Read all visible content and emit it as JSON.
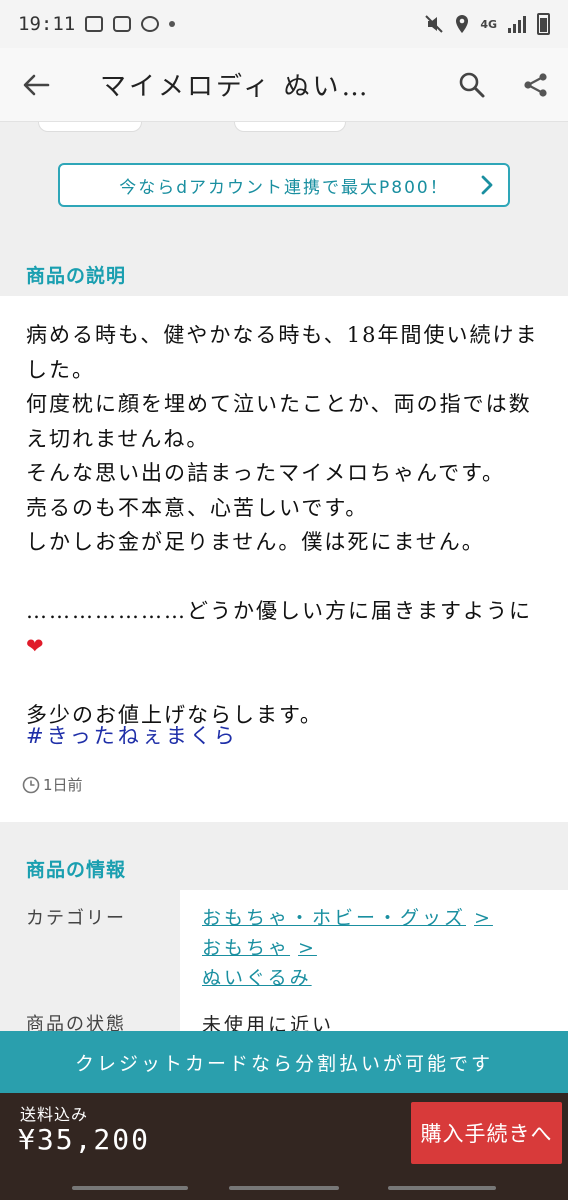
{
  "status_bar": {
    "time": "19:11",
    "network": "4G",
    "icons": [
      "image-icon",
      "app-icon",
      "chat-icon",
      "mute-icon",
      "location-icon",
      "signal-icon",
      "battery-icon"
    ]
  },
  "header": {
    "title": "マイメロディ ぬい…",
    "icons": [
      "back-arrow-icon",
      "search-icon",
      "share-icon"
    ]
  },
  "banner": {
    "text": "今ならdアカウント連携で最大P800！"
  },
  "description": {
    "section_title": "商品の説明",
    "body": "病める時も、健やかなる時も、18年間使い続けました。\n何度枕に顔を埋めて泣いたことか、両の指では数え切れませんね。\nそんな思い出の詰まったマイメロちゃんです。\n売るのも不本意、心苦しいです。\nしかしお金が足りません。僕は死にません。\n\n…………………どうか優しい方に届きますように",
    "heart": "❤",
    "body_end": "\n\n多少のお値上げならします。",
    "hashtag": "#きったねぇまくら",
    "posted": "1日前"
  },
  "info": {
    "section_title": "商品の情報",
    "category_label": "カテゴリー",
    "categories": [
      "おもちゃ・ホビー・グッズ",
      "おもちゃ",
      "ぬいぐるみ"
    ],
    "condition_label": "商品の状態",
    "condition_value": "未使用に近い"
  },
  "credit_bar": {
    "text": "クレジットカードなら分割払いが可能です"
  },
  "purchase": {
    "shipping_label": "送料込み",
    "price": "¥35,200",
    "buy_button": "購入手続きへ"
  },
  "colors": {
    "accent": "#2a9fad",
    "buy_button": "#d83a3a",
    "bottom_bar": "#332621",
    "hashtag": "#1f2fa8"
  }
}
